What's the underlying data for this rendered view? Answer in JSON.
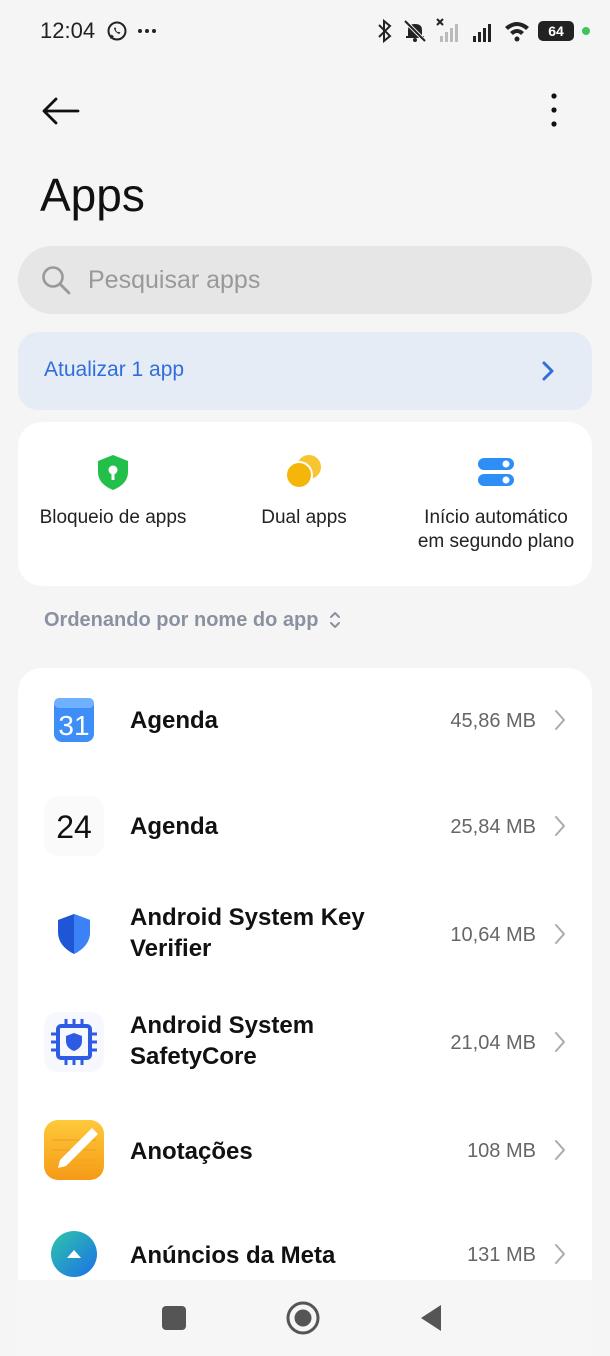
{
  "status_bar": {
    "time": "12:04",
    "battery": "64",
    "icons": [
      "whatsapp-icon",
      "more-notifications-icon",
      "bluetooth-icon",
      "silent-icon",
      "no-signal-icon",
      "signal-icon",
      "wifi-icon",
      "battery-icon"
    ]
  },
  "header": {
    "title": "Apps"
  },
  "search": {
    "placeholder": "Pesquisar apps"
  },
  "update_banner": {
    "label": "Atualizar 1 app"
  },
  "features": [
    {
      "label": "Bloqueio de apps",
      "icon": "shield-lock-icon",
      "color": "#22c04b"
    },
    {
      "label": "Dual apps",
      "icon": "dual-circles-icon",
      "color": "#f5b60b"
    },
    {
      "label_line1": "Início automático",
      "label_line2": "em segundo plano",
      "icon": "toggles-icon",
      "color": "#2f8ef5"
    }
  ],
  "sort": {
    "label": "Ordenando por nome do app"
  },
  "apps": [
    {
      "name": "Agenda",
      "size": "45,86 MB",
      "icon": "calendar-31-icon",
      "icon_text": "31"
    },
    {
      "name": "Agenda",
      "size": "25,84 MB",
      "icon": "calendar-24-icon",
      "icon_text": "24"
    },
    {
      "name_line1": "Android System Key",
      "name_line2": "Verifier",
      "size": "10,64 MB",
      "icon": "key-verifier-shield-icon"
    },
    {
      "name_line1": "Android System",
      "name_line2": "SafetyCore",
      "size": "21,04 MB",
      "icon": "safetycore-chip-icon"
    },
    {
      "name": "Anotações",
      "size": "108 MB",
      "icon": "notes-pencil-icon"
    },
    {
      "name": "Anúncios da Meta",
      "size": "131 MB",
      "icon": "meta-ads-icon"
    }
  ],
  "colors": {
    "accent": "#2f6fdb",
    "background": "#f5f5f5"
  }
}
